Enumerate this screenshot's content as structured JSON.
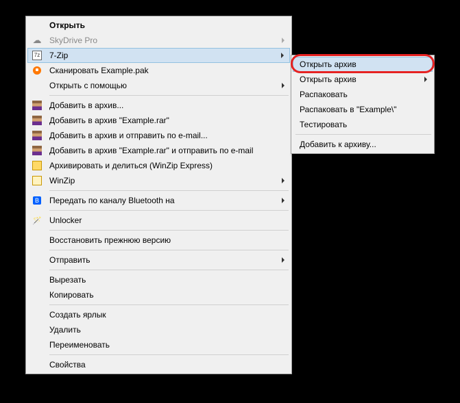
{
  "main_menu": {
    "items": [
      {
        "label": "Открыть",
        "icon": null,
        "header": true
      },
      {
        "label": "SkyDrive Pro",
        "icon": "cloud",
        "disabled": true,
        "submenu": true
      },
      {
        "label": "7-Zip",
        "icon": "7z",
        "hovered": true,
        "submenu": true
      },
      {
        "label": "Сканировать Example.pak",
        "icon": "avast"
      },
      {
        "label": "Открыть с помощью",
        "icon": null,
        "submenu": true
      },
      {
        "sep": true
      },
      {
        "label": "Добавить в архив...",
        "icon": "rar"
      },
      {
        "label": "Добавить в архив \"Example.rar\"",
        "icon": "rar"
      },
      {
        "label": "Добавить в архив и отправить по e-mail...",
        "icon": "rar"
      },
      {
        "label": "Добавить в архив \"Example.rar\" и отправить по e-mail",
        "icon": "rar"
      },
      {
        "label": "Архивировать и делиться (WinZip Express)",
        "icon": "wzexp"
      },
      {
        "label": "WinZip",
        "icon": "wz",
        "submenu": true
      },
      {
        "sep": true
      },
      {
        "label": "Передать по каналу Bluetooth на",
        "icon": "bt",
        "submenu": true
      },
      {
        "sep": true
      },
      {
        "label": "Unlocker",
        "icon": "wand"
      },
      {
        "sep": true
      },
      {
        "label": "Восстановить прежнюю версию",
        "icon": null
      },
      {
        "sep": true
      },
      {
        "label": "Отправить",
        "icon": null,
        "submenu": true
      },
      {
        "sep": true
      },
      {
        "label": "Вырезать",
        "icon": null
      },
      {
        "label": "Копировать",
        "icon": null
      },
      {
        "sep": true
      },
      {
        "label": "Создать ярлык",
        "icon": null
      },
      {
        "label": "Удалить",
        "icon": null
      },
      {
        "label": "Переименовать",
        "icon": null
      },
      {
        "sep": true
      },
      {
        "label": "Свойства",
        "icon": null
      }
    ]
  },
  "sub_menu": {
    "items": [
      {
        "label": "Открыть архив",
        "hovered": true,
        "highlight": true
      },
      {
        "label": "Открыть архив",
        "submenu": true
      },
      {
        "label": "Распаковать",
        "disabled": false
      },
      {
        "label": "Распаковать в \"Example\\\""
      },
      {
        "label": "Тестировать"
      },
      {
        "sep": true
      },
      {
        "label": "Добавить к архиву..."
      }
    ]
  },
  "icons": {
    "cloud": "i-cloud",
    "7z": "i-7z",
    "avast": "i-avast",
    "rar": "i-rar",
    "wzexp": "i-wzexp",
    "wz": "i-wz",
    "bt": "i-bt",
    "wand": "i-wand"
  }
}
